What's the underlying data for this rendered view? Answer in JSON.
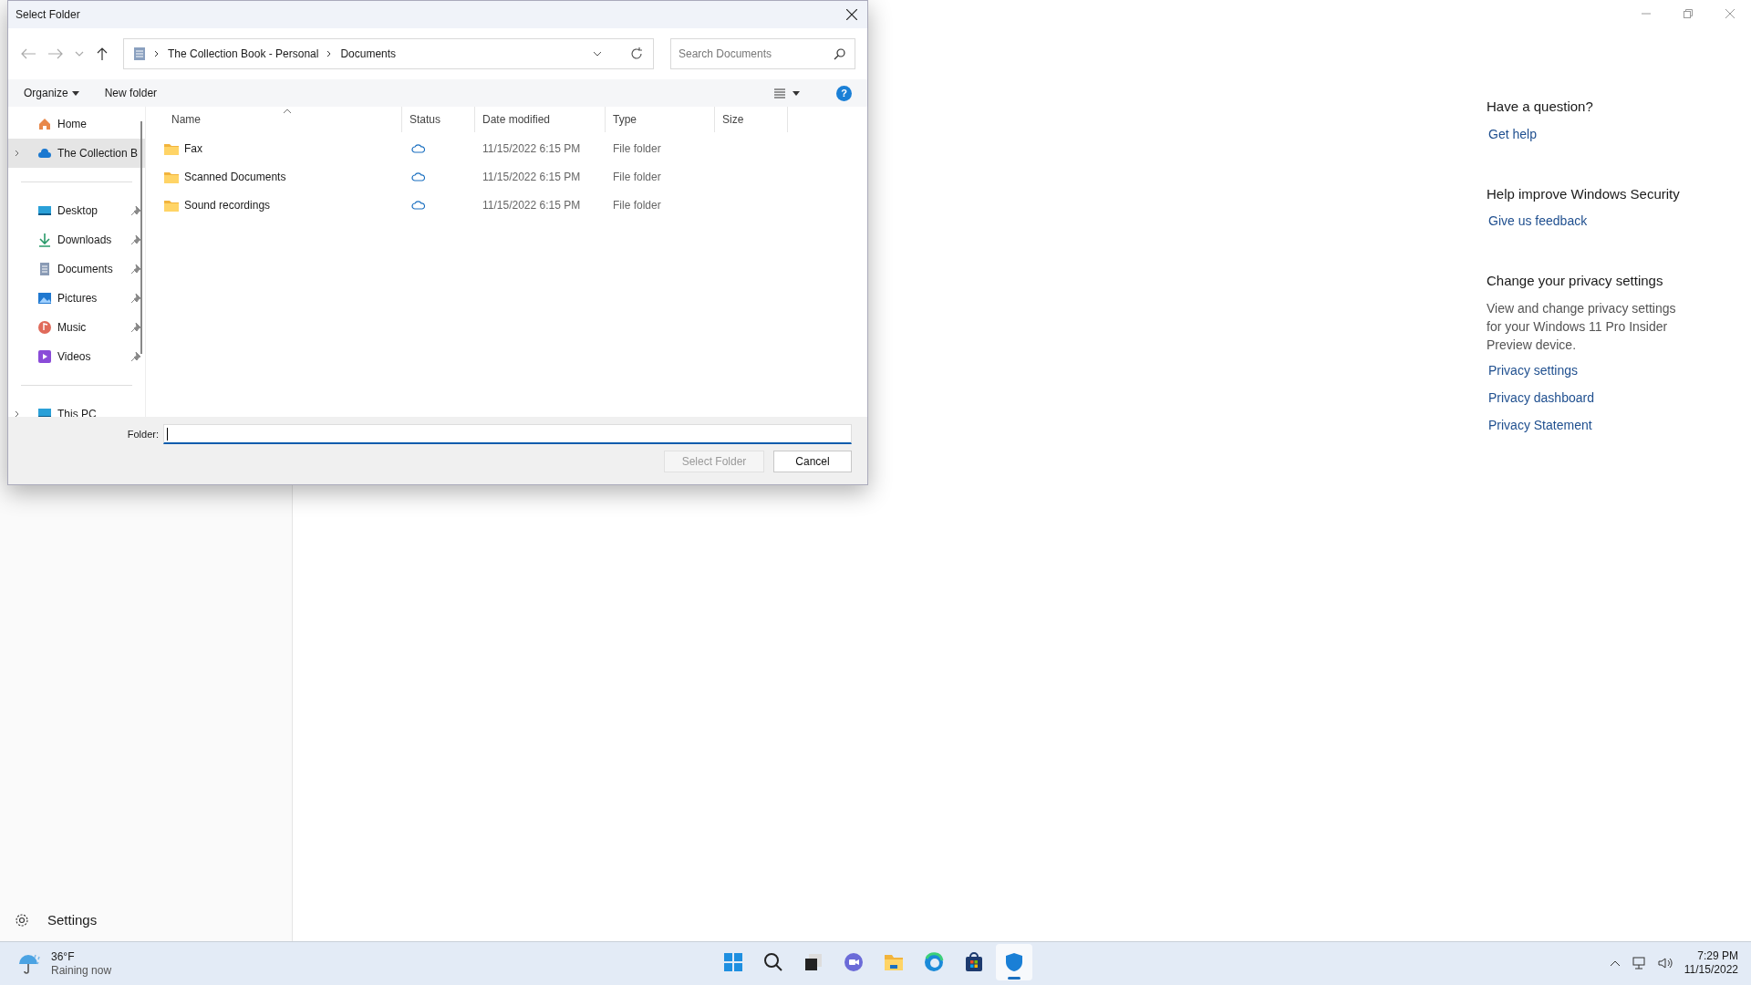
{
  "background_app": {
    "settings_label": "Settings",
    "sections": [
      {
        "heading": "Have a question?",
        "links": [
          "Get help"
        ]
      },
      {
        "heading": "Help improve Windows Security",
        "links": [
          "Give us feedback"
        ]
      },
      {
        "heading": "Change your privacy settings",
        "text": "View and change privacy settings for your Windows 11 Pro Insider Preview device.",
        "links": [
          "Privacy settings",
          "Privacy dashboard",
          "Privacy Statement"
        ]
      }
    ]
  },
  "dialog": {
    "title": "Select Folder",
    "breadcrumb": [
      "The Collection Book - Personal",
      "Documents"
    ],
    "search": {
      "placeholder": "Search Documents"
    },
    "toolbar": {
      "organize": "Organize",
      "new_folder": "New folder",
      "help": "?"
    },
    "nav_groups": [
      [
        {
          "label": "Home",
          "kind": "home",
          "selected": false,
          "expandable": false,
          "pinned": false
        },
        {
          "label": "The Collection B",
          "kind": "cloud",
          "selected": true,
          "expandable": true,
          "pinned": false
        }
      ],
      [
        {
          "label": "Desktop",
          "kind": "desktop",
          "selected": false,
          "expandable": false,
          "pinned": true
        },
        {
          "label": "Downloads",
          "kind": "download",
          "selected": false,
          "expandable": false,
          "pinned": true
        },
        {
          "label": "Documents",
          "kind": "document",
          "selected": false,
          "expandable": false,
          "pinned": true
        },
        {
          "label": "Pictures",
          "kind": "pictures",
          "selected": false,
          "expandable": false,
          "pinned": true
        },
        {
          "label": "Music",
          "kind": "music",
          "selected": false,
          "expandable": false,
          "pinned": true
        },
        {
          "label": "Videos",
          "kind": "videos",
          "selected": false,
          "expandable": false,
          "pinned": true
        }
      ],
      [
        {
          "label": "This PC",
          "kind": "pc",
          "selected": false,
          "expandable": true,
          "pinned": false
        }
      ]
    ],
    "columns": [
      "Name",
      "Status",
      "Date modified",
      "Type",
      "Size"
    ],
    "rows": [
      {
        "name": "Fax",
        "date": "11/15/2022 6:15 PM",
        "type": "File folder"
      },
      {
        "name": "Scanned Documents",
        "date": "11/15/2022 6:15 PM",
        "type": "File folder"
      },
      {
        "name": "Sound recordings",
        "date": "11/15/2022 6:15 PM",
        "type": "File folder"
      }
    ],
    "folder_label": "Folder:",
    "buttons": [
      {
        "label": "Select Folder",
        "disabled": true
      },
      {
        "label": "Cancel",
        "disabled": false
      }
    ]
  },
  "taskbar": {
    "weather": {
      "temperature": "36°F",
      "condition": "Raining now"
    },
    "apps": [
      {
        "kind": "start",
        "active": false
      },
      {
        "kind": "search",
        "active": false
      },
      {
        "kind": "task-view",
        "active": false
      },
      {
        "kind": "chat",
        "active": false
      },
      {
        "kind": "folder",
        "active": false
      },
      {
        "kind": "browser",
        "active": false
      },
      {
        "kind": "store",
        "active": false
      },
      {
        "kind": "shield",
        "active": true
      }
    ],
    "time": "7:29 PM",
    "date": "11/15/2022"
  }
}
